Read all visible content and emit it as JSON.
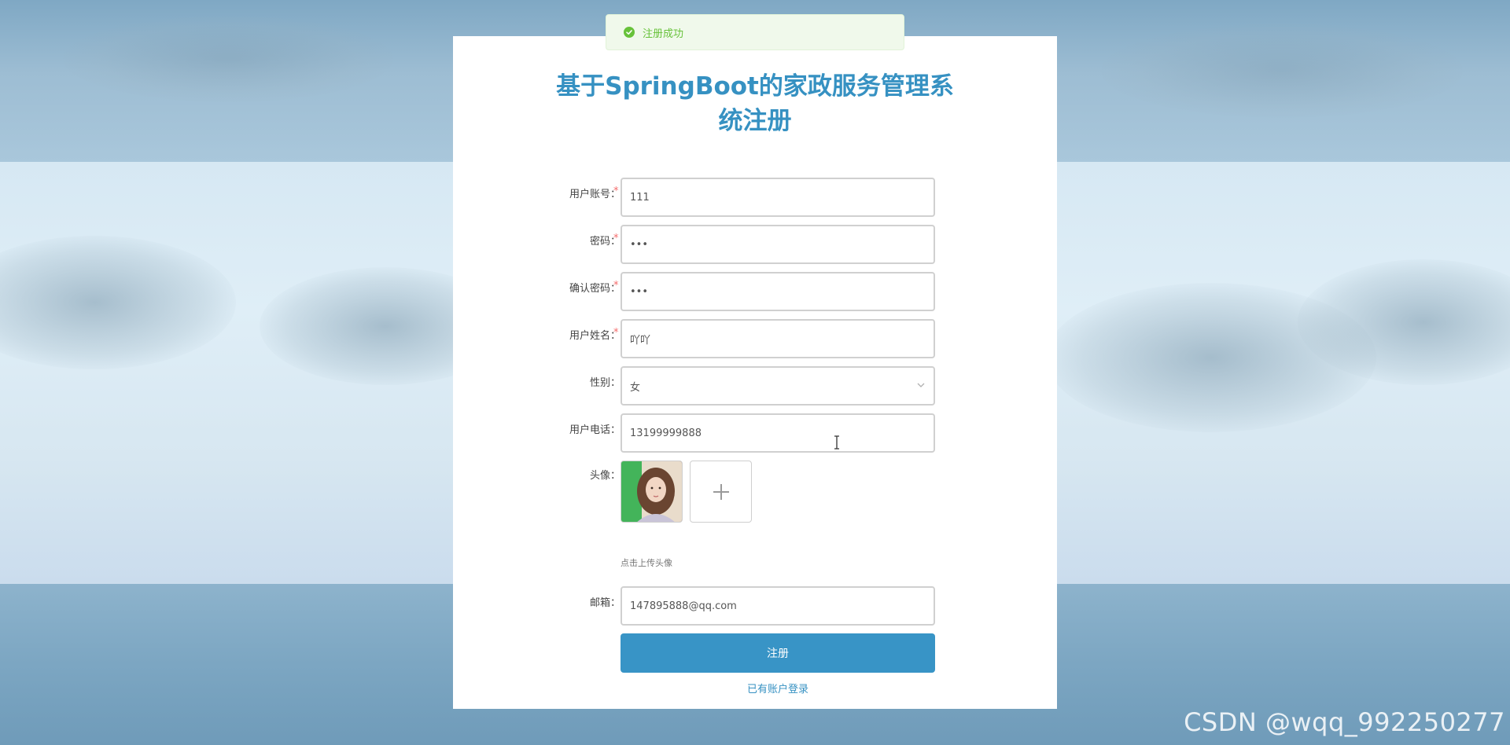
{
  "toast": {
    "message": "注册成功",
    "type": "success"
  },
  "title": {
    "line1": "基于SpringBoot的家政服务管理系",
    "line2": "统注册"
  },
  "form": {
    "account": {
      "label": "用户账号：",
      "required": "*",
      "value": "111"
    },
    "password": {
      "label": "密码：",
      "required": "*",
      "value": "•••"
    },
    "confirm_password": {
      "label": "确认密码：",
      "required": "*",
      "value": "•••"
    },
    "name": {
      "label": "用户姓名：",
      "required": "*",
      "value": "吖吖"
    },
    "gender": {
      "label": "性别：",
      "value": "女"
    },
    "phone": {
      "label": "用户电话：",
      "value": "13199999888"
    },
    "avatar": {
      "label": "头像：",
      "hint": "点击上传头像"
    },
    "email": {
      "label": "邮箱：",
      "value": "147895888@qq.com"
    }
  },
  "actions": {
    "submit_label": "注册",
    "login_link": "已有账户登录"
  },
  "watermark": "CSDN @wqq_992250277",
  "colors": {
    "accent": "#3894c6",
    "title": "#3691c2",
    "required": "#f56c6c",
    "toast_bg": "#f0f9eb",
    "toast_text": "#67c23a"
  },
  "icons": {
    "toast": "check-circle-icon",
    "select": "chevron-down-icon",
    "upload": "plus-icon",
    "cursor": "text-cursor-icon"
  }
}
